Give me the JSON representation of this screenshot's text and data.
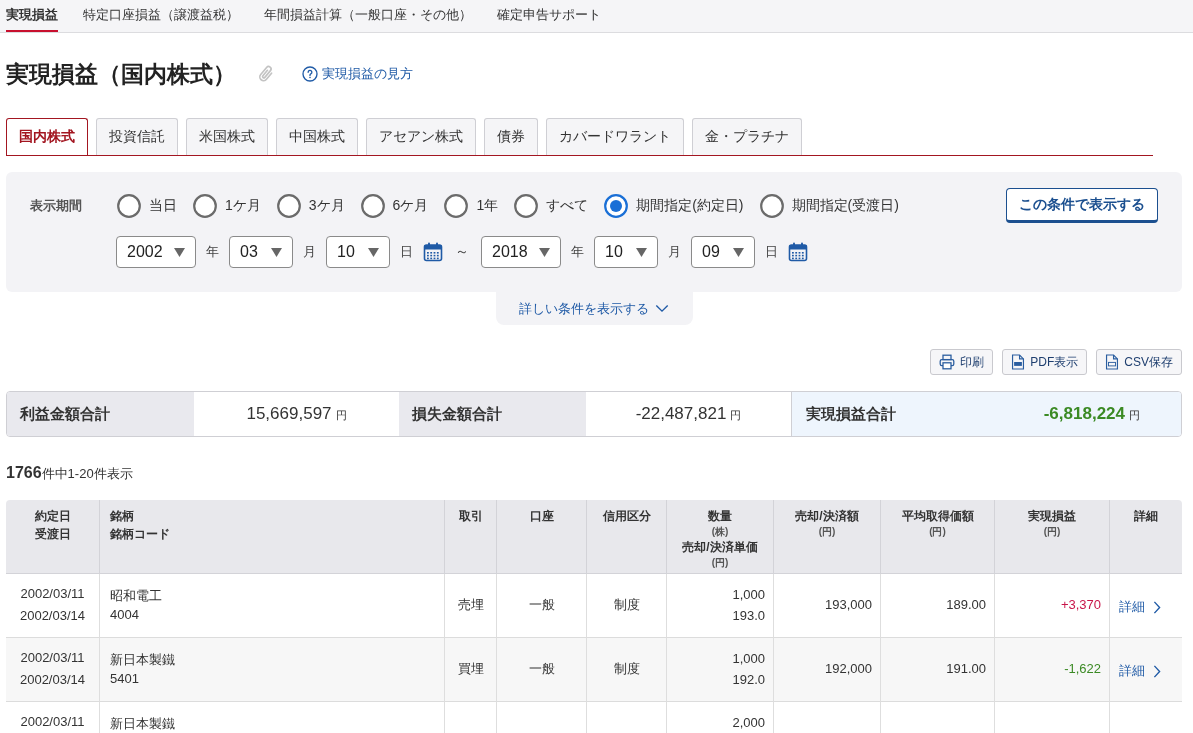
{
  "top_nav": [
    {
      "label": "実現損益",
      "selected": true
    },
    {
      "label": "特定口座損益（譲渡益税）",
      "selected": false
    },
    {
      "label": "年間損益計算（一般口座・その他）",
      "selected": false
    },
    {
      "label": "確定申告サポート",
      "selected": false
    }
  ],
  "page_title": "実現損益（国内株式）",
  "help_link": "実現損益の見方",
  "tabs": [
    {
      "label": "国内株式",
      "selected": true
    },
    {
      "label": "投資信託",
      "selected": false
    },
    {
      "label": "米国株式",
      "selected": false
    },
    {
      "label": "中国株式",
      "selected": false
    },
    {
      "label": "アセアン株式",
      "selected": false
    },
    {
      "label": "債券",
      "selected": false
    },
    {
      "label": "カバードワラント",
      "selected": false
    },
    {
      "label": "金・プラチナ",
      "selected": false
    }
  ],
  "filter": {
    "label": "表示期間",
    "options": [
      {
        "label": "当日",
        "selected": false
      },
      {
        "label": "1ケ月",
        "selected": false
      },
      {
        "label": "3ケ月",
        "selected": false
      },
      {
        "label": "6ケ月",
        "selected": false
      },
      {
        "label": "1年",
        "selected": false
      },
      {
        "label": "すべて",
        "selected": false
      },
      {
        "label": "期間指定(約定日)",
        "selected": true
      },
      {
        "label": "期間指定(受渡日)",
        "selected": false
      }
    ],
    "button": "この条件で表示する",
    "from": [
      {
        "value": "2002",
        "unit": "年"
      },
      {
        "value": "03",
        "unit": "月"
      },
      {
        "value": "10",
        "unit": "日"
      }
    ],
    "separator": "～",
    "to": [
      {
        "value": "2018",
        "unit": "年"
      },
      {
        "value": "10",
        "unit": "月"
      },
      {
        "value": "09",
        "unit": "日"
      }
    ],
    "more_link": "詳しい条件を表示する"
  },
  "actions": [
    {
      "label": "印刷",
      "kind": "print"
    },
    {
      "label": "PDF表示",
      "kind": "pdf"
    },
    {
      "label": "CSV保存",
      "kind": "csv"
    }
  ],
  "summary": [
    {
      "label": "利益金額合計",
      "value": "15,669,597",
      "unit": "円"
    },
    {
      "label": "損失金額合計",
      "value": "-22,487,821",
      "unit": "円"
    }
  ],
  "total": {
    "label": "実現損益合計",
    "value": "-6,818,224",
    "unit": "円",
    "loss": true
  },
  "result_count": "**1766**件中1-20件表示",
  "table": {
    "columns": [
      {
        "parts": [
          {
            "text": "約定日",
            "kind": "title"
          },
          {
            "text": "受渡日",
            "kind": "title"
          }
        ]
      },
      {
        "parts": [
          {
            "text": "銘柄",
            "kind": "title"
          },
          {
            "text": "銘柄コード",
            "kind": "title"
          }
        ]
      },
      {
        "parts": [
          {
            "text": "取引",
            "kind": "title"
          }
        ]
      },
      {
        "parts": [
          {
            "text": "口座",
            "kind": "title"
          }
        ]
      },
      {
        "parts": [
          {
            "text": "信用区分",
            "kind": "title"
          }
        ]
      },
      {
        "parts": [
          {
            "text": "数量",
            "kind": "title"
          },
          {
            "text": "(株)",
            "kind": "unit"
          },
          {
            "text": "売却/決済単価",
            "kind": "title"
          },
          {
            "text": "(円)",
            "kind": "unit"
          }
        ]
      },
      {
        "parts": [
          {
            "text": "売却/決済額",
            "kind": "title"
          },
          {
            "text": "(円)",
            "kind": "unit"
          }
        ]
      },
      {
        "parts": [
          {
            "text": "平均取得価額",
            "kind": "title"
          },
          {
            "text": "(円)",
            "kind": "unit"
          }
        ]
      },
      {
        "parts": [
          {
            "text": "実現損益",
            "kind": "title"
          },
          {
            "text": "(円)",
            "kind": "unit"
          }
        ]
      },
      {
        "parts": [
          {
            "text": "詳細",
            "kind": "title"
          }
        ]
      }
    ],
    "rows": [
      {
        "trade_date": "2002/03/11",
        "settle_date": "2002/03/14",
        "name": "昭和電工",
        "code": "4004",
        "trade": "売埋",
        "account": "一般",
        "margin_type": "制度",
        "quantity": "1,000",
        "unit_price": "193.0",
        "amount": "193,000",
        "avg_cost": "189.00",
        "profit": "+3,370",
        "loss": false,
        "detail": "詳細"
      },
      {
        "trade_date": "2002/03/11",
        "settle_date": "2002/03/14",
        "name": "新日本製鐵",
        "code": "5401",
        "trade": "買埋",
        "account": "一般",
        "margin_type": "制度",
        "quantity": "1,000",
        "unit_price": "192.0",
        "amount": "192,000",
        "avg_cost": "191.00",
        "profit": "-1,622",
        "loss": true,
        "detail": "詳細"
      },
      {
        "trade_date": "2002/03/11",
        "name": "新日本製鐵",
        "quantity": "2,000"
      }
    ]
  }
}
